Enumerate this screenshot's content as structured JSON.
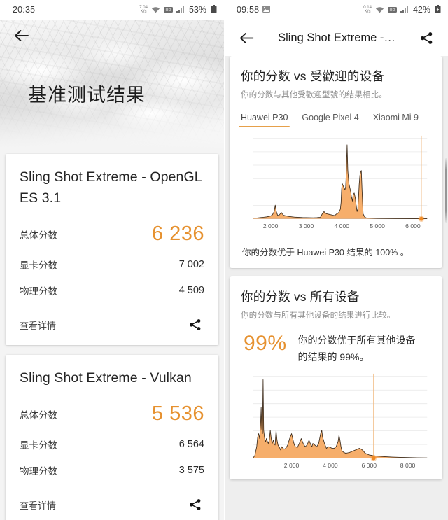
{
  "left": {
    "status": {
      "time": "20:35",
      "net_rate": "7.04",
      "net_unit": "K/s",
      "battery": "53%",
      "icons": [
        "data-rate-icon",
        "wifi-icon",
        "hd-icon",
        "signal-icon",
        "battery-icon"
      ]
    },
    "header": {
      "back_icon": "back-arrow-icon",
      "title": "基准测试结果"
    },
    "cards": [
      {
        "title": "Sling Shot Extreme - OpenGL ES 3.1",
        "rows": [
          {
            "label": "总体分数",
            "value": "6 236",
            "highlight": true
          },
          {
            "label": "显卡分数",
            "value": "7 002",
            "highlight": false
          },
          {
            "label": "物理分数",
            "value": "4 509",
            "highlight": false
          }
        ],
        "footer_link": "查看详情",
        "share_icon": "share-icon"
      },
      {
        "title": "Sling Shot Extreme - Vulkan",
        "rows": [
          {
            "label": "总体分数",
            "value": "5 536",
            "highlight": true
          },
          {
            "label": "显卡分数",
            "value": "6 564",
            "highlight": false
          },
          {
            "label": "物理分数",
            "value": "3 575",
            "highlight": false
          }
        ],
        "footer_link": "查看详情",
        "share_icon": "share-icon"
      }
    ]
  },
  "right": {
    "status": {
      "time": "09:58",
      "screenshot_icon": "screenshot-icon",
      "net_rate": "0.14",
      "net_unit": "K/s",
      "battery": "42%",
      "icons": [
        "data-rate-icon",
        "wifi-icon",
        "hd-icon",
        "signal-icon",
        "battery-charging-icon"
      ]
    },
    "appbar": {
      "back_icon": "back-arrow-icon",
      "title": "Sling Shot Extreme -…",
      "share_icon": "share-icon"
    },
    "card_popular": {
      "title": "你的分数 vs 受歡迎的设备",
      "subtitle": "你的分数与其他受歡迎型號的结果相比。",
      "tabs": [
        {
          "label": "Huawei P30",
          "active": true
        },
        {
          "label": "Google Pixel 4",
          "active": false
        },
        {
          "label": "Xiaomi Mi 9",
          "active": false
        }
      ],
      "note": "你的分数优于 Huawei P30 结果的 100% 。"
    },
    "card_all": {
      "title": "你的分数 vs 所有设备",
      "subtitle": "你的分数与所有其他设备的结果进行比较。",
      "percent": "99%",
      "percent_text": "你的分数优于所有其他设备的结果的 99%。"
    },
    "scrollbar": "vertical-scrollbar"
  },
  "colors": {
    "accent": "#e6912f",
    "chart_fill": "#f5aa63",
    "chart_stroke": "#3d2b1a",
    "marker": "#f08a24",
    "grid": "#e8e8e8",
    "tab_underline": "#e6a04a"
  },
  "chart_data": [
    {
      "type": "area",
      "title": "你的分数 vs 受歡迎的设备",
      "name": "huawei-p30-distribution",
      "xlabel": "",
      "ylabel": "",
      "xlim": [
        1500,
        6400
      ],
      "ylim": [
        0,
        100
      ],
      "grid": true,
      "xticks": [
        2000,
        3000,
        4000,
        5000,
        6000
      ],
      "xticklabels": [
        "2 000",
        "3 000",
        "4 000",
        "5 000",
        "6 000"
      ],
      "marker": {
        "x": 6236,
        "y": 0,
        "label": "你的分数",
        "color": "#f08a24"
      },
      "x": [
        1500,
        1600,
        1700,
        1800,
        1900,
        1950,
        2000,
        2050,
        2100,
        2130,
        2160,
        2200,
        2250,
        2300,
        2330,
        2360,
        2400,
        2450,
        2500,
        2600,
        2700,
        2800,
        2900,
        3000,
        3100,
        3200,
        3300,
        3400,
        3450,
        3500,
        3520,
        3560,
        3600,
        3650,
        3700,
        3750,
        3800,
        3850,
        3900,
        3930,
        3960,
        3980,
        3995,
        4010,
        4030,
        4050,
        4070,
        4090,
        4110,
        4130,
        4150,
        4170,
        4200,
        4230,
        4250,
        4270,
        4300,
        4320,
        4350,
        4380,
        4400,
        4430,
        4450,
        4470,
        4490,
        4510,
        4530,
        4550,
        4570,
        4600,
        4650,
        4700,
        5000,
        5500,
        6000,
        6400
      ],
      "y": [
        1,
        1,
        1.5,
        2,
        2.5,
        3,
        3.5,
        5,
        9,
        17,
        9,
        4,
        5,
        8,
        6,
        4.5,
        4,
        3.5,
        3,
        2.5,
        2,
        1.8,
        1.6,
        1.5,
        1.4,
        1.3,
        1.5,
        2,
        6,
        9,
        8,
        6.5,
        6,
        5.5,
        5,
        4.5,
        4,
        6,
        7,
        9,
        12,
        20,
        36,
        44,
        42,
        40,
        38,
        36,
        40,
        60,
        92,
        60,
        44,
        38,
        34,
        28,
        22,
        30,
        32,
        26,
        18,
        9,
        12,
        26,
        43,
        54,
        58,
        60,
        36,
        6,
        2,
        1,
        0.5,
        0.3,
        0.2,
        0.1
      ]
    },
    {
      "type": "area",
      "title": "你的分数 vs 所有设备",
      "name": "all-devices-distribution",
      "xlabel": "",
      "ylabel": "",
      "xlim": [
        0,
        9000
      ],
      "ylim": [
        0,
        100
      ],
      "grid": true,
      "xticks": [
        2000,
        4000,
        6000,
        8000
      ],
      "xticklabels": [
        "2 000",
        "4 000",
        "6 000",
        "8 000"
      ],
      "marker": {
        "x": 6236,
        "y": 0,
        "label": "你的分数",
        "color": "#f08a24"
      },
      "x": [
        0,
        100,
        200,
        250,
        300,
        350,
        400,
        430,
        460,
        500,
        530,
        560,
        600,
        630,
        660,
        700,
        730,
        760,
        800,
        850,
        900,
        950,
        1000,
        1030,
        1060,
        1100,
        1150,
        1200,
        1250,
        1300,
        1350,
        1400,
        1430,
        1460,
        1500,
        1560,
        1620,
        1700,
        1800,
        1900,
        2000,
        2100,
        2150,
        2200,
        2300,
        2400,
        2500,
        2600,
        2700,
        2800,
        2900,
        3000,
        3050,
        3100,
        3200,
        3300,
        3400,
        3500,
        3560,
        3600,
        3700,
        3800,
        3900,
        4000,
        4100,
        4200,
        4300,
        4400,
        4450,
        4500,
        4550,
        4600,
        4700,
        4800,
        4900,
        5000,
        5200,
        5400,
        5500,
        5600,
        5700,
        5800,
        6000,
        6236,
        6400,
        6800,
        7200,
        7600,
        8000,
        8500,
        9000
      ],
      "y": [
        0,
        3,
        14,
        26,
        30,
        24,
        42,
        62,
        36,
        30,
        96,
        34,
        26,
        22,
        20,
        24,
        22,
        20,
        18,
        22,
        34,
        24,
        18,
        20,
        22,
        18,
        16,
        34,
        22,
        16,
        14,
        12,
        10,
        12,
        14,
        12,
        11,
        12,
        16,
        24,
        30,
        20,
        16,
        14,
        13,
        18,
        24,
        18,
        14,
        16,
        22,
        16,
        14,
        18,
        16,
        14,
        18,
        30,
        34,
        26,
        18,
        12,
        14,
        13,
        12,
        12,
        14,
        20,
        28,
        22,
        14,
        9,
        7,
        6,
        6.5,
        7,
        9,
        11,
        12,
        11,
        9,
        6,
        4,
        3,
        2.5,
        1.8,
        1.3,
        1,
        0.8,
        0.5,
        0.3
      ]
    }
  ]
}
